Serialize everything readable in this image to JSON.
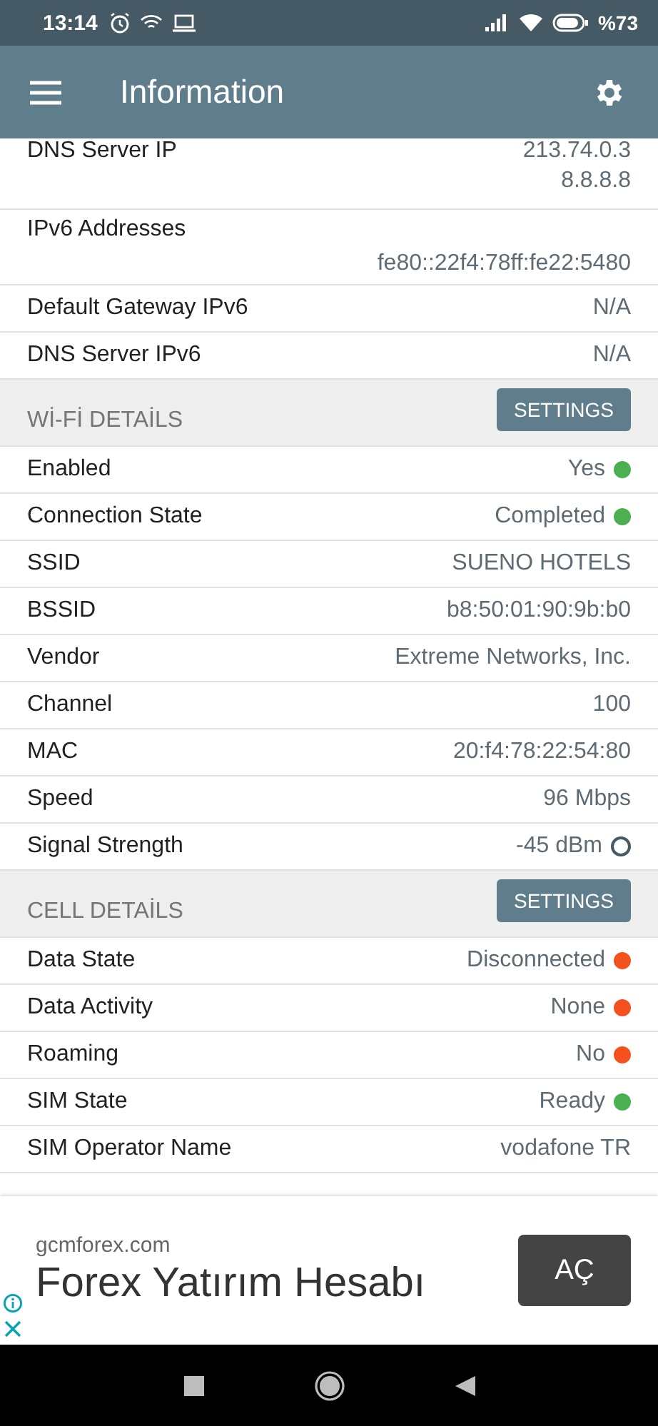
{
  "status_bar": {
    "time": "13:14",
    "battery": "%73"
  },
  "app_bar": {
    "title": "Information"
  },
  "sections": [
    {
      "rows": [
        {
          "label": "DNS Server IP",
          "values": [
            "213.74.0.3",
            "8.8.8.8"
          ],
          "kind": "pair"
        },
        {
          "label": "IPv6 Addresses",
          "values": [
            "fe80::22f4:78ff:fe22:5480"
          ],
          "kind": "stacked"
        },
        {
          "label": "Default Gateway IPv6",
          "values": [
            "N/A"
          ],
          "kind": "pair"
        },
        {
          "label": "DNS Server IPv6",
          "values": [
            "N/A"
          ],
          "kind": "pair"
        }
      ]
    },
    {
      "title": "Wİ-Fİ DETAİLS",
      "button": "SETTINGS",
      "rows": [
        {
          "label": "Enabled",
          "values": [
            "Yes"
          ],
          "kind": "dot",
          "color": "#4caf50"
        },
        {
          "label": "Connection State",
          "values": [
            "Completed"
          ],
          "kind": "dot",
          "color": "#4caf50"
        },
        {
          "label": "SSID",
          "values": [
            "SUENO HOTELS"
          ],
          "kind": "pair"
        },
        {
          "label": "BSSID",
          "values": [
            "b8:50:01:90:9b:b0"
          ],
          "kind": "pair"
        },
        {
          "label": "Vendor",
          "values": [
            "Extreme Networks, Inc."
          ],
          "kind": "pair"
        },
        {
          "label": "Channel",
          "values": [
            "100"
          ],
          "kind": "pair"
        },
        {
          "label": "MAC",
          "values": [
            "20:f4:78:22:54:80"
          ],
          "kind": "pair"
        },
        {
          "label": "Speed",
          "values": [
            "96 Mbps"
          ],
          "kind": "pair"
        },
        {
          "label": "Signal Strength",
          "values": [
            "-45 dBm"
          ],
          "kind": "ring"
        }
      ]
    },
    {
      "title": "CELL DETAİLS",
      "button": "SETTINGS",
      "rows": [
        {
          "label": "Data State",
          "values": [
            "Disconnected"
          ],
          "kind": "dot",
          "color": "#f4511e"
        },
        {
          "label": "Data Activity",
          "values": [
            "None"
          ],
          "kind": "dot",
          "color": "#f4511e"
        },
        {
          "label": "Roaming",
          "values": [
            "No"
          ],
          "kind": "dot",
          "color": "#f4511e"
        },
        {
          "label": "SIM State",
          "values": [
            "Ready"
          ],
          "kind": "dot",
          "color": "#4caf50"
        },
        {
          "label": "SIM Operator Name",
          "values": [
            "vodafone TR"
          ],
          "kind": "pair"
        }
      ]
    }
  ],
  "ad": {
    "domain": "gcmforex.com",
    "headline": "Forex Yatırım Hesabı",
    "button": "AÇ"
  }
}
